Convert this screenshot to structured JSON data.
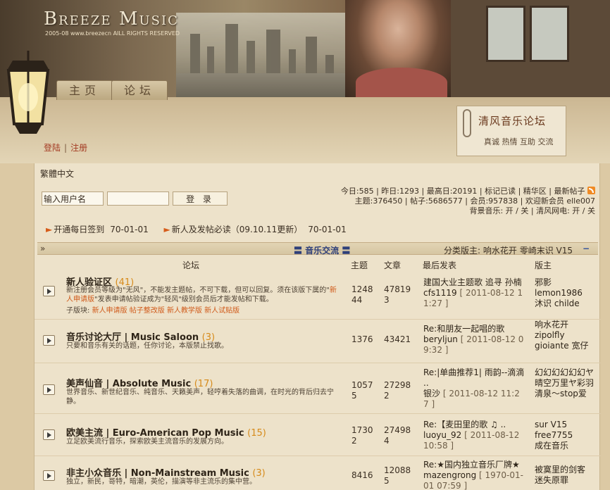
{
  "site": {
    "logo": "Breeze Music",
    "copyright": "2005-08 www.breezecn AILL RIGHTS RESERVED",
    "nav_tabs": [
      "主页",
      "论坛"
    ],
    "auth": {
      "login": "登陆",
      "register": "注册",
      "separator": "|"
    },
    "forum_card": {
      "title": "清风音乐论坛",
      "tagline": "真诚 热情 互助 交流"
    }
  },
  "toolbar": {
    "language": "繁體中文"
  },
  "login": {
    "username_value": "输入用户名",
    "password_value": "",
    "button": "登 录"
  },
  "stats": {
    "line1": "今日:585 | 昨日:1293 | 最高日:20191 | 标记已读 | 精华区 | 最新帖子",
    "line2": "主题:376450 | 帖子:5686577 | 会员:957838 | 欢迎新会员 elle007",
    "line3": "背景音乐: 开 / 关 | 清风网电: 开 / 关"
  },
  "announcements": [
    {
      "text": "开通每日签到",
      "date": "70-01-01"
    },
    {
      "text": "新人及发帖必读（09.10.11更新）",
      "date": "70-01-01"
    }
  ],
  "category": {
    "expand_icon": "»",
    "title": "〓 音乐交流 〓",
    "moderators": "分类版主: 响水花开 零崎末识 V15",
    "collapse_icon": "−"
  },
  "columns": {
    "forum": "论坛",
    "topics": "主题",
    "posts": "文章",
    "last_post": "最后发表",
    "moderators": "版主"
  },
  "forums": [
    {
      "name": "新人验证区",
      "count": "(41)",
      "desc_pre": "新注册会员等级为\"无风\"，不能发主题帖，不可下载，但可以回复。须在该版下属的\"",
      "desc_hl": "新人申请版",
      "desc_post": "\"发表申请帖验证成为\"轻风\"级别会员后才能发帖和下载。",
      "sub_label": "子版块:",
      "subforums": [
        "新人申请版",
        "帖子整改版",
        "新人教学版",
        "新人试贴版"
      ],
      "topics": "1248\n44",
      "posts": "47819\n3",
      "last_title": "建国大业主题歌 追寻 孙楠",
      "last_user": "cfs1119",
      "last_time": "[ 2011-08-12 11:27 ]",
      "mods": "邪影\nlemon1986\n沐识 childe"
    },
    {
      "name": "音乐讨论大厅 | Music Saloon",
      "count": "(3)",
      "desc_pre": "只要和音乐有关的话题，任你讨论，本版禁止找歌。",
      "desc_hl": "",
      "desc_post": "",
      "topics": "1376",
      "posts": "43421",
      "last_title": "Re:和朋友一起唱的歌",
      "last_user": "beryljun",
      "last_time": "[ 2011-08-12 09:32 ]",
      "mods": "响水花开\nzipolfly\ngioiante 宽仔"
    },
    {
      "name": "美声仙音 | Absolute Music",
      "count": "(17)",
      "desc_pre": "世界音乐、新世纪音乐、纯音乐、天籁美声，轻哼着失落的曲调，在时光的背后归去宁静。",
      "desc_hl": "",
      "desc_post": "",
      "topics": "1057\n5",
      "posts": "27298\n2",
      "last_title": "Re:|单曲推荐1| 雨韵--滴滴 ..",
      "last_user": "银沙",
      "last_time": "[ 2011-08-12 11:27 ]",
      "mods": "幻幻幻幻幻幻ヤ晴空万里ヤ彩羽清泉～stop爱"
    },
    {
      "name": "欧美主流 | Euro-American Pop Music",
      "count": "(15)",
      "desc_pre": "立足欧美流行音乐，探索欧美主流音乐的发展方向。",
      "desc_hl": "",
      "desc_post": "",
      "topics": "1730\n2",
      "posts": "27498\n4",
      "last_title": "Re:【麦田里的歌 ♫ ..",
      "last_user": "luoyu_92",
      "last_time": "[ 2011-08-12 10:58 ]",
      "mods": "sur V15\nfree7755\n成在音乐"
    },
    {
      "name": "非主小众音乐 | Non-Mainstream Music",
      "count": "(3)",
      "desc_pre": "独立，新民，哥特，暗潮，英伦，描演等非主流乐的集中营。",
      "desc_hl": "",
      "desc_post": "",
      "topics": "8416",
      "posts": "12088\n5",
      "last_title": "Re:★国内独立音乐厂牌★",
      "last_user": "mazengrong",
      "last_time": "[ 1970-01-01 07:59 ]",
      "mods": "被寞里的剑客\n迷失原罪"
    }
  ],
  "colors": {
    "accent_orange": "#d68a1a",
    "link_red": "#a33a22",
    "category_blue": "#2e3f7a",
    "bg_main": "#ede2ca"
  }
}
